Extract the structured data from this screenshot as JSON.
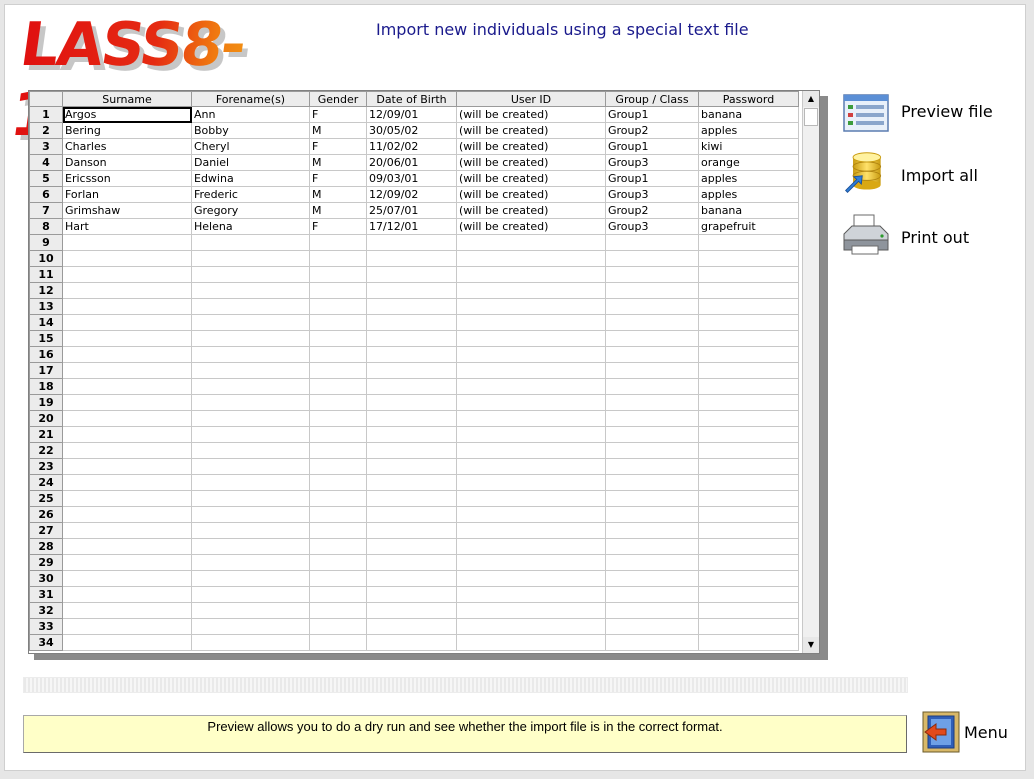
{
  "app": {
    "logo_text": "LASS8-11",
    "title": "Import new individuals using a special text file"
  },
  "table": {
    "columns": [
      "Surname",
      "Forename(s)",
      "Gender",
      "Date of Birth",
      "User ID",
      "Group / Class",
      "Password"
    ],
    "rows": [
      [
        "Argos",
        "Ann",
        "F",
        "12/09/01",
        "(will be created)",
        "Group1",
        "banana"
      ],
      [
        "Bering",
        "Bobby",
        "M",
        "30/05/02",
        "(will be created)",
        "Group2",
        "apples"
      ],
      [
        "Charles",
        "Cheryl",
        "F",
        "11/02/02",
        "(will be created)",
        "Group1",
        "kiwi"
      ],
      [
        "Danson",
        "Daniel",
        "M",
        "20/06/01",
        "(will be created)",
        "Group3",
        "orange"
      ],
      [
        "Ericsson",
        "Edwina",
        "F",
        "09/03/01",
        "(will be created)",
        "Group1",
        "apples"
      ],
      [
        "Forlan",
        "Frederic",
        "M",
        "12/09/02",
        "(will be created)",
        "Group3",
        "apples"
      ],
      [
        "Grimshaw",
        "Gregory",
        "M",
        "25/07/01",
        "(will be created)",
        "Group2",
        "banana"
      ],
      [
        "Hart",
        "Helena",
        "F",
        "17/12/01",
        "(will be created)",
        "Group3",
        "grapefruit"
      ]
    ],
    "row_numbers": [
      "1",
      "2",
      "3",
      "4",
      "5",
      "6",
      "7",
      "8",
      "9",
      "10",
      "11",
      "12",
      "13",
      "14",
      "15",
      "16",
      "17",
      "18",
      "19",
      "20",
      "21",
      "22",
      "23",
      "24",
      "25",
      "26",
      "27",
      "28",
      "29",
      "30",
      "31",
      "32",
      "33",
      "34"
    ]
  },
  "actions": {
    "preview_label": "Preview file",
    "import_label": "Import all",
    "print_label": "Print out"
  },
  "icons": {
    "preview": "preview-file-icon",
    "import": "database-import-icon",
    "print": "printer-icon",
    "menu": "exit-door-icon"
  },
  "status": {
    "message": "Preview allows you to do a dry run and see whether the import file is in the correct format."
  },
  "menu": {
    "label": "Menu"
  },
  "colors": {
    "title": "#1a1a8c",
    "status_bg": "#ffffc8"
  }
}
